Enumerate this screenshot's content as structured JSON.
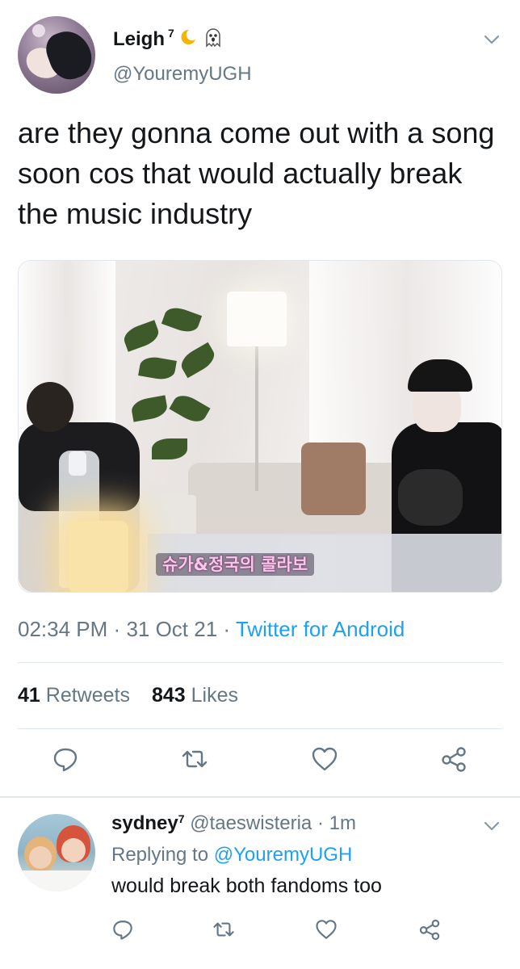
{
  "tweet": {
    "display_name": "Leigh",
    "name_superscript": "7",
    "name_emojis": [
      "crescent-moon",
      "ghost"
    ],
    "handle": "@YouremyUGH",
    "text": "are they gonna come out with a song soon cos that would actually break the music industry",
    "media_caption": "슈가&정국의 콜라보",
    "time": "02:34 PM",
    "separator": "·",
    "date": "31 Oct 21",
    "source": "Twitter for Android",
    "retweets_count": "41",
    "retweets_label": "Retweets",
    "likes_count": "843",
    "likes_label": "Likes",
    "action_icons": [
      "reply-icon",
      "retweet-icon",
      "like-icon",
      "share-icon"
    ]
  },
  "reply": {
    "display_name": "sydney",
    "name_superscript": "7",
    "handle": "@taeswisteria",
    "separator": "·",
    "age": "1m",
    "replying_prefix": "Replying to",
    "replying_to": "@YouremyUGH",
    "text": "would break both fandoms too",
    "action_icons": [
      "reply-icon",
      "retweet-icon",
      "like-icon",
      "share-icon"
    ]
  },
  "colors": {
    "text_primary": "#14171a",
    "text_secondary": "#657786",
    "link_blue": "#1da1f2",
    "divider": "#e1e8ed"
  }
}
